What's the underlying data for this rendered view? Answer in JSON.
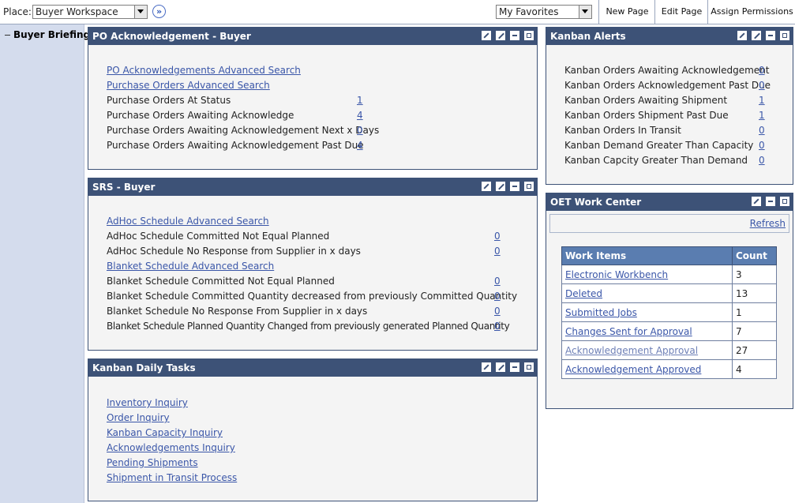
{
  "topbar": {
    "place_label": "Place:",
    "place_value": "Buyer Workspace",
    "favorites_value": "My Favorites",
    "new_page": "New Page",
    "edit_page": "Edit Page",
    "assign_permissions": "Assign Permissions"
  },
  "sidebar": {
    "item": "Buyer Briefing"
  },
  "po_ack": {
    "title": "PO Acknowledgement - Buyer",
    "links": [
      "PO Acknowledgements Advanced Search",
      "Purchase Orders Advanced Search"
    ],
    "rows": [
      {
        "label": "Purchase Orders At Status",
        "count": "1"
      },
      {
        "label": "Purchase Orders Awaiting Acknowledge",
        "count": "4"
      },
      {
        "label": "Purchase Orders Awaiting Acknowledgement Next x Days",
        "count": "0"
      },
      {
        "label": "Purchase Orders Awaiting Acknowledgement Past Due",
        "count": "4"
      }
    ]
  },
  "srs": {
    "title": "SRS - Buyer",
    "items": [
      {
        "label": "AdHoc Schedule Advanced Search",
        "link": true,
        "count": ""
      },
      {
        "label": "AdHoc Schedule Committed Not Equal Planned",
        "link": false,
        "count": "0"
      },
      {
        "label": "AdHoc Schedule No Response from Supplier in x days",
        "link": false,
        "count": "0"
      },
      {
        "label": "Blanket Schedule Advanced Search",
        "link": true,
        "count": ""
      },
      {
        "label": "Blanket Schedule Committed Not Equal Planned",
        "link": false,
        "count": "0"
      },
      {
        "label": "Blanket Schedule Committed Quantity decreased from previously Committed Quantity",
        "link": false,
        "count": "0"
      },
      {
        "label": "Blanket Schedule No Response From Supplier in x days",
        "link": false,
        "count": "0"
      },
      {
        "label": "Blanket Schedule Planned Quantity Changed from previously generated Planned Quantity",
        "link": false,
        "count": "0"
      }
    ]
  },
  "kanban_tasks": {
    "title": "Kanban Daily Tasks",
    "links": [
      "Inventory Inquiry",
      "Order Inquiry",
      "Kanban Capacity Inquiry",
      "Acknowledgements Inquiry",
      "Pending Shipments",
      "Shipment in Transit Process"
    ]
  },
  "kanban_alerts": {
    "title": "Kanban Alerts",
    "rows": [
      {
        "label": "Kanban Orders Awaiting Acknowledgement",
        "count": "0"
      },
      {
        "label": "Kanban Orders Acknowledgement Past Due",
        "count": "0"
      },
      {
        "label": "Kanban Orders Awaiting Shipment",
        "count": "1"
      },
      {
        "label": "Kanban Orders Shipment Past Due",
        "count": "1"
      },
      {
        "label": "Kanban Orders In Transit",
        "count": "0"
      },
      {
        "label": "Kanban Demand Greater Than Capacity",
        "count": "0"
      },
      {
        "label": "Kanban Capcity Greater Than Demand",
        "count": "0"
      }
    ]
  },
  "oet": {
    "title": "OET Work Center",
    "refresh": "Refresh",
    "col_items": "Work Items",
    "col_count": "Count",
    "rows": [
      {
        "item": "Electronic Workbench",
        "count": "3"
      },
      {
        "item": "Deleted",
        "count": "13"
      },
      {
        "item": "Submitted Jobs",
        "count": "1"
      },
      {
        "item": "Changes Sent for Approval",
        "count": "7"
      },
      {
        "item": "Acknowledgement Approval",
        "count": "27"
      },
      {
        "item": "Acknowledgement Approved",
        "count": "4"
      }
    ]
  }
}
